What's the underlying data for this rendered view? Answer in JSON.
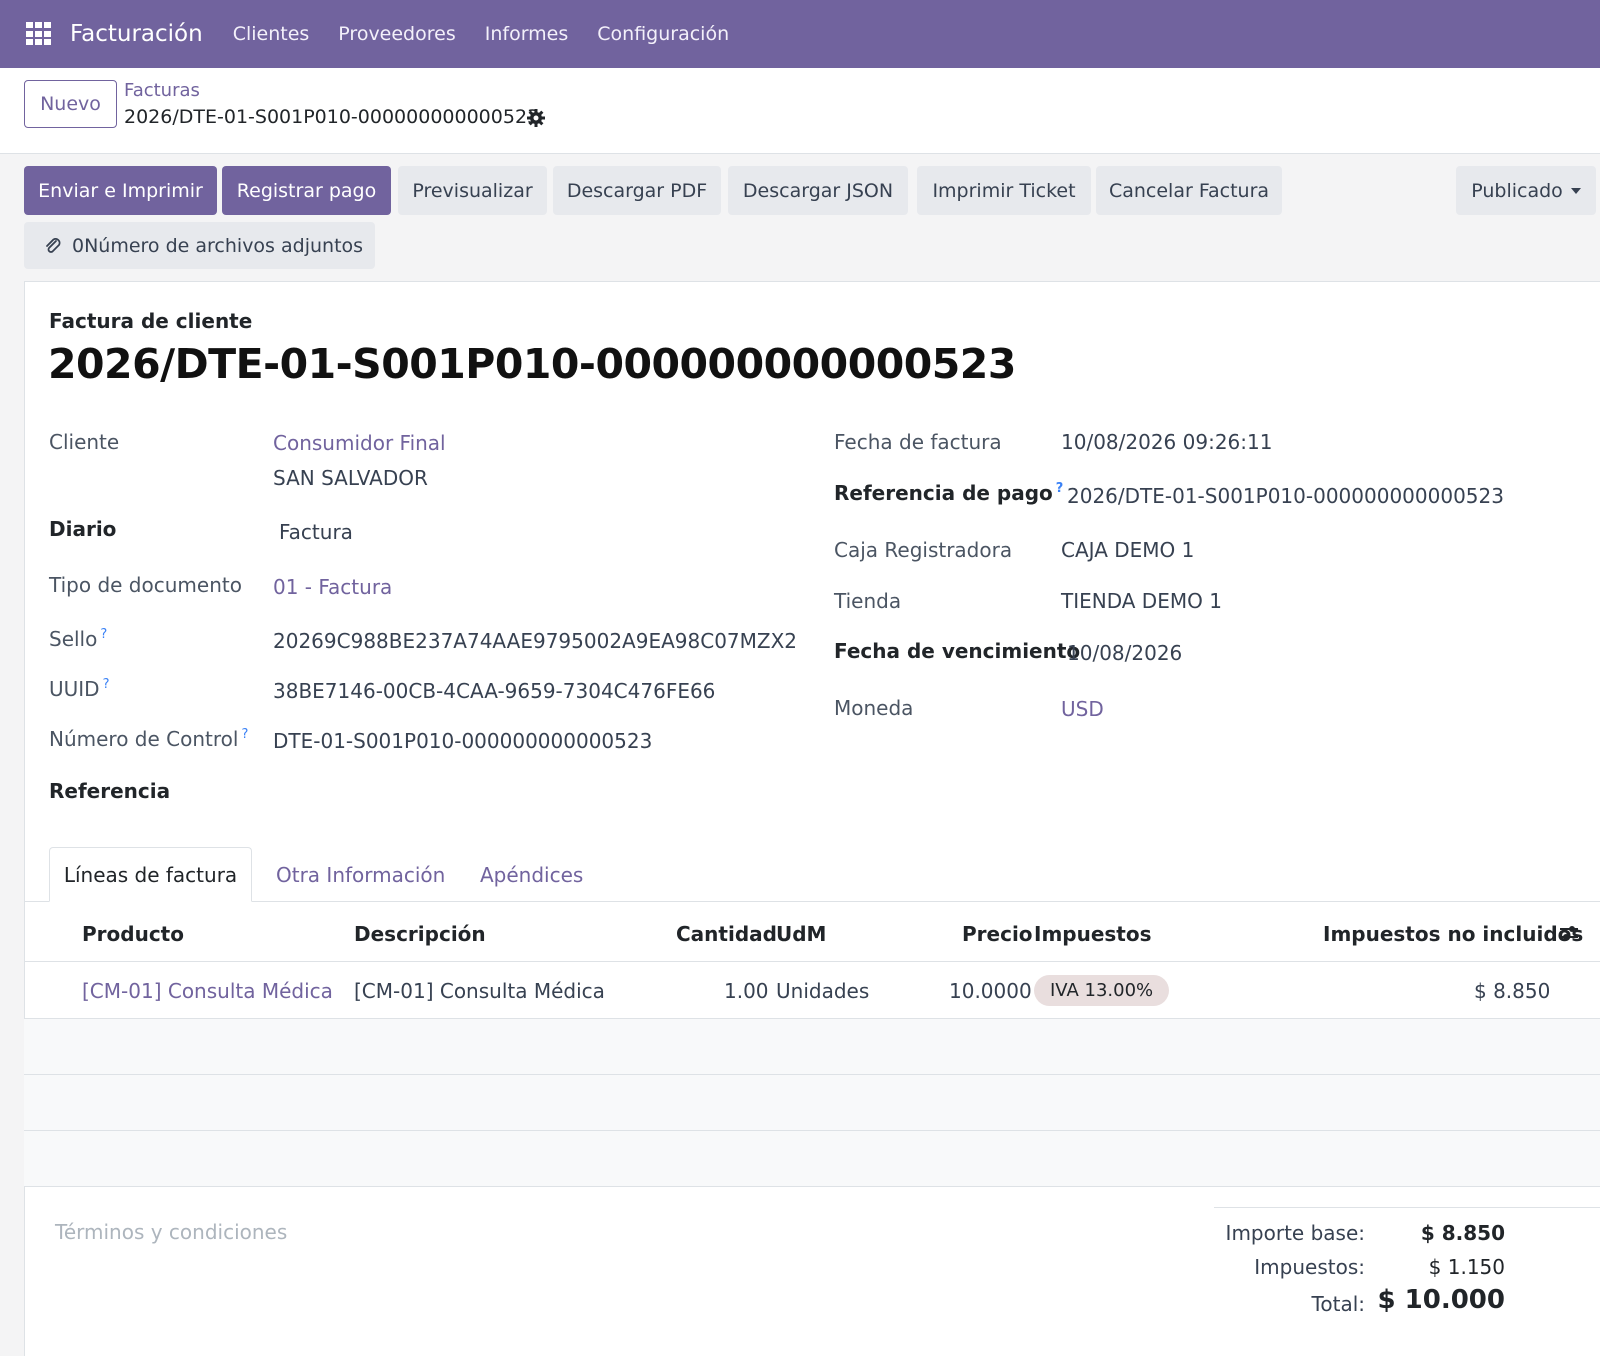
{
  "navbar": {
    "app_name": "Facturación",
    "menu": [
      "Clientes",
      "Proveedores",
      "Informes",
      "Configuración"
    ]
  },
  "control_panel": {
    "new_button": "Nuevo",
    "breadcrumb_parent": "Facturas",
    "breadcrumb_current": "2026/DTE-01-S001P010-000000000000523"
  },
  "actions": {
    "send_print": "Enviar e Imprimir",
    "register_payment": "Registrar pago",
    "preview": "Previsualizar",
    "download_pdf": "Descargar PDF",
    "download_json": "Descargar JSON",
    "print_ticket": "Imprimir Ticket",
    "cancel_invoice": "Cancelar Factura",
    "status": "Publicado",
    "attachments": "0Número de archivos adjuntos"
  },
  "document": {
    "type": "Factura de cliente",
    "name": "2026/DTE-01-S001P010-000000000000523"
  },
  "fields_left": {
    "cliente_label": "Cliente",
    "cliente_value": "Consumidor Final",
    "cliente_address": "SAN SALVADOR",
    "diario_label": "Diario",
    "diario_value": "Factura",
    "tipo_label": "Tipo de documento",
    "tipo_value": "01 - Factura",
    "sello_label": "Sello",
    "sello_value": "20269C988BE237A74AAE9795002A9EA98C07MZX2",
    "uuid_label": "UUID",
    "uuid_value": "38BE7146-00CB-4CAA-9659-7304C476FE66",
    "control_label": "Número de Control",
    "control_value": "DTE-01-S001P010-000000000000523",
    "referencia_label": "Referencia"
  },
  "fields_right": {
    "fecha_label": "Fecha de factura",
    "fecha_value": "10/08/2026 09:26:11",
    "ref_pago_label": "Referencia de pago",
    "ref_pago_value": "2026/DTE-01-S001P010-000000000000523",
    "caja_label": "Caja Registradora",
    "caja_value": "CAJA DEMO 1",
    "tienda_label": "Tienda",
    "tienda_value": "TIENDA DEMO 1",
    "vencimiento_label": "Fecha de vencimiento",
    "vencimiento_value": "10/08/2026",
    "moneda_label": "Moneda",
    "moneda_value": "USD"
  },
  "tabs": [
    "Líneas de factura",
    "Otra Información",
    "Apéndices"
  ],
  "table": {
    "headers": {
      "producto": "Producto",
      "descripcion": "Descripción",
      "cantidad": "Cantidad",
      "udm": "UdM",
      "precio": "Precio",
      "impuestos": "Impuestos",
      "subtotal": "Impuestos no incluidos"
    },
    "rows": [
      {
        "producto": "[CM-01] Consulta Médica",
        "descripcion": "[CM-01] Consulta Médica",
        "cantidad": "1.00",
        "udm": "Unidades",
        "precio": "10.0000",
        "impuestos": "IVA 13.00%",
        "subtotal": "$ 8.850"
      }
    ]
  },
  "footer": {
    "terms_placeholder": "Términos y condiciones",
    "base_label": "Importe base:",
    "base_value": "$ 8.850",
    "tax_label": "Impuestos:",
    "tax_value": "$ 1.150",
    "total_label": "Total:",
    "total_value": "$ 10.000"
  },
  "help_marker": "?",
  "colors": {
    "brand": "#71639e",
    "secondary_button": "#e7e9ed",
    "tax_badge": "#e9dede"
  }
}
